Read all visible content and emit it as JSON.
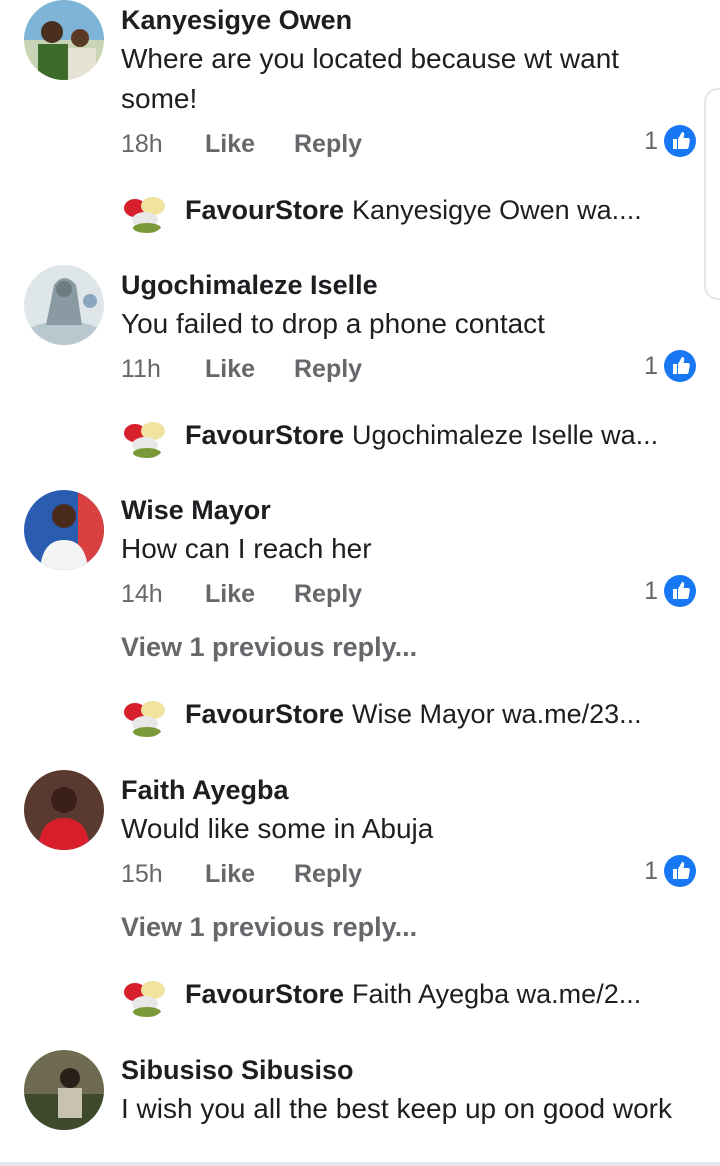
{
  "comments": [
    {
      "author": "Kanyesigye Owen",
      "text": "Where are you located because wt want some!",
      "time": "18h",
      "like_label": "Like",
      "reply_label": "Reply",
      "reaction_count": "1",
      "reply": {
        "name": "FavourStore",
        "text": "Kanyesigye Owen wa...."
      }
    },
    {
      "author": "Ugochimaleze Iselle",
      "text": "You failed to drop a phone contact",
      "time": "11h",
      "like_label": "Like",
      "reply_label": "Reply",
      "reaction_count": "1",
      "reply": {
        "name": "FavourStore",
        "text": "Ugochimaleze Iselle wa..."
      }
    },
    {
      "author": "Wise Mayor",
      "text": "How can I reach her",
      "time": "14h",
      "like_label": "Like",
      "reply_label": "Reply",
      "reaction_count": "1",
      "view_previous": "View 1 previous reply...",
      "reply": {
        "name": "FavourStore",
        "text": "Wise Mayor wa.me/23..."
      }
    },
    {
      "author": "Faith Ayegba",
      "text": "Would like some in Abuja",
      "time": "15h",
      "like_label": "Like",
      "reply_label": "Reply",
      "reaction_count": "1",
      "view_previous": "View 1 previous reply...",
      "reply": {
        "name": "FavourStore",
        "text": "Faith Ayegba wa.me/2..."
      }
    },
    {
      "author": "Sibusiso Sibusiso",
      "text": "I wish you all the best keep up on good work"
    }
  ],
  "icons": {
    "reaction": "like-thumb-icon",
    "avatar": "profile-photo"
  },
  "colors": {
    "like_blue": "#1877f2",
    "meta_gray": "#65676b",
    "text": "#1c1e21"
  }
}
